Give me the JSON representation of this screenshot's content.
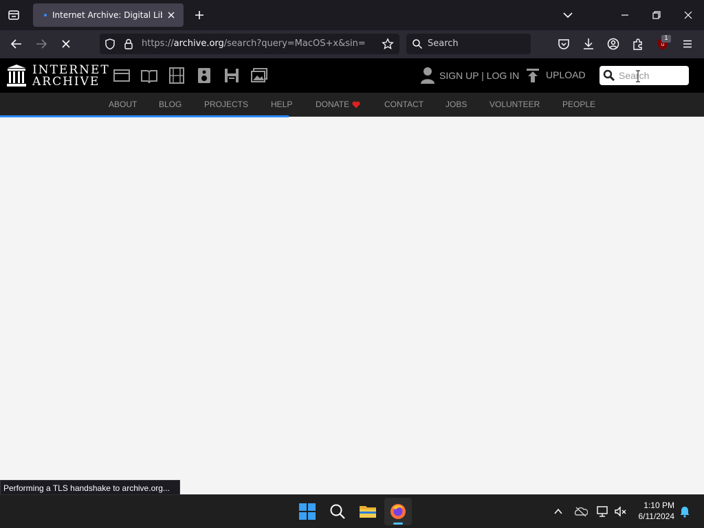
{
  "browser": {
    "tab_title": "Internet Archive: Digital Library",
    "url_prefix": "https://",
    "url_host": "archive.org",
    "url_path": "/search?query=MacOS+x&sin=",
    "search_placeholder": "Search",
    "extension_badge": "1"
  },
  "site": {
    "logo_line1": "INTERNET",
    "logo_line2": "ARCHIVE",
    "signup_login": "SIGN UP | LOG IN",
    "upload": "UPLOAD",
    "search_placeholder": "Search",
    "nav": [
      "ABOUT",
      "BLOG",
      "PROJECTS",
      "HELP",
      "DONATE",
      "CONTACT",
      "JOBS",
      "VOLUNTEER",
      "PEOPLE"
    ],
    "media_icons": [
      "web-icon",
      "texts-icon",
      "video-icon",
      "audio-icon",
      "software-icon",
      "images-icon"
    ],
    "accent": "#2a8cff",
    "donate_heart_color": "#e02020"
  },
  "status_text": "Performing a TLS handshake to archive.org...",
  "taskbar": {
    "time": "1:10 PM",
    "date": "6/11/2024"
  }
}
